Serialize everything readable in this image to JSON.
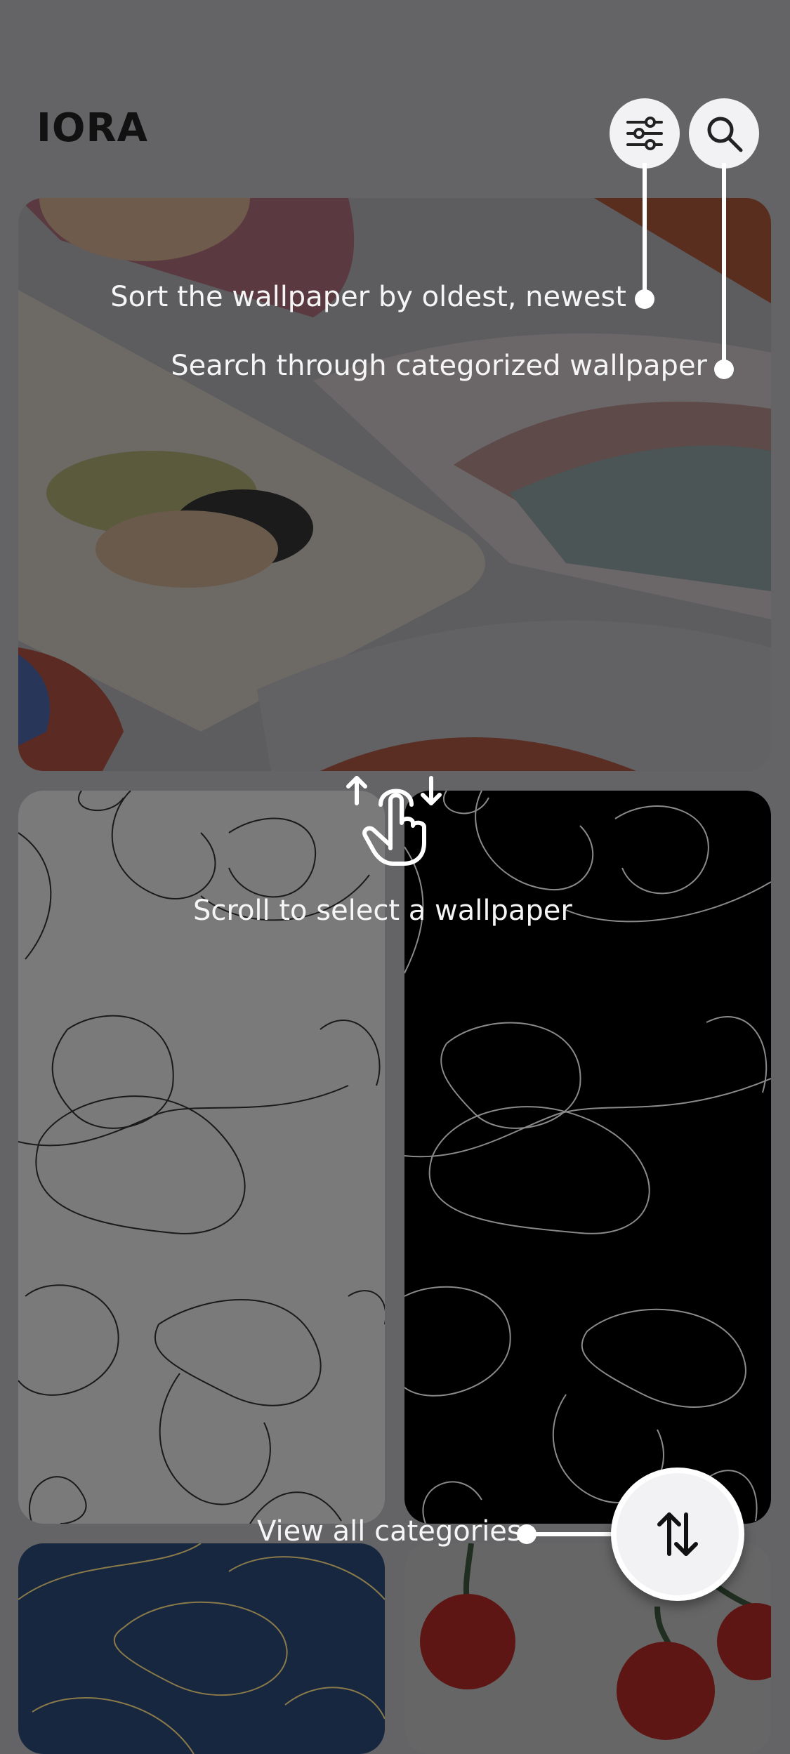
{
  "header": {
    "app_title": "IORA"
  },
  "icons": {
    "filter": "sliders-icon",
    "search": "search-icon",
    "sort_toggle": "swap-vertical-icon",
    "gesture": "scroll-gesture-icon"
  },
  "tutorial": {
    "sort_hint": "Sort the wallpaper by oldest, newest",
    "search_hint": "Search through categorized wallpaper",
    "scroll_hint": "Scroll to select a wallpaper",
    "categories_hint": "View all categories"
  },
  "colors": {
    "overlay": "#646466",
    "hint_text": "#f5f5f5",
    "button_bg": "#f2f2f4"
  }
}
